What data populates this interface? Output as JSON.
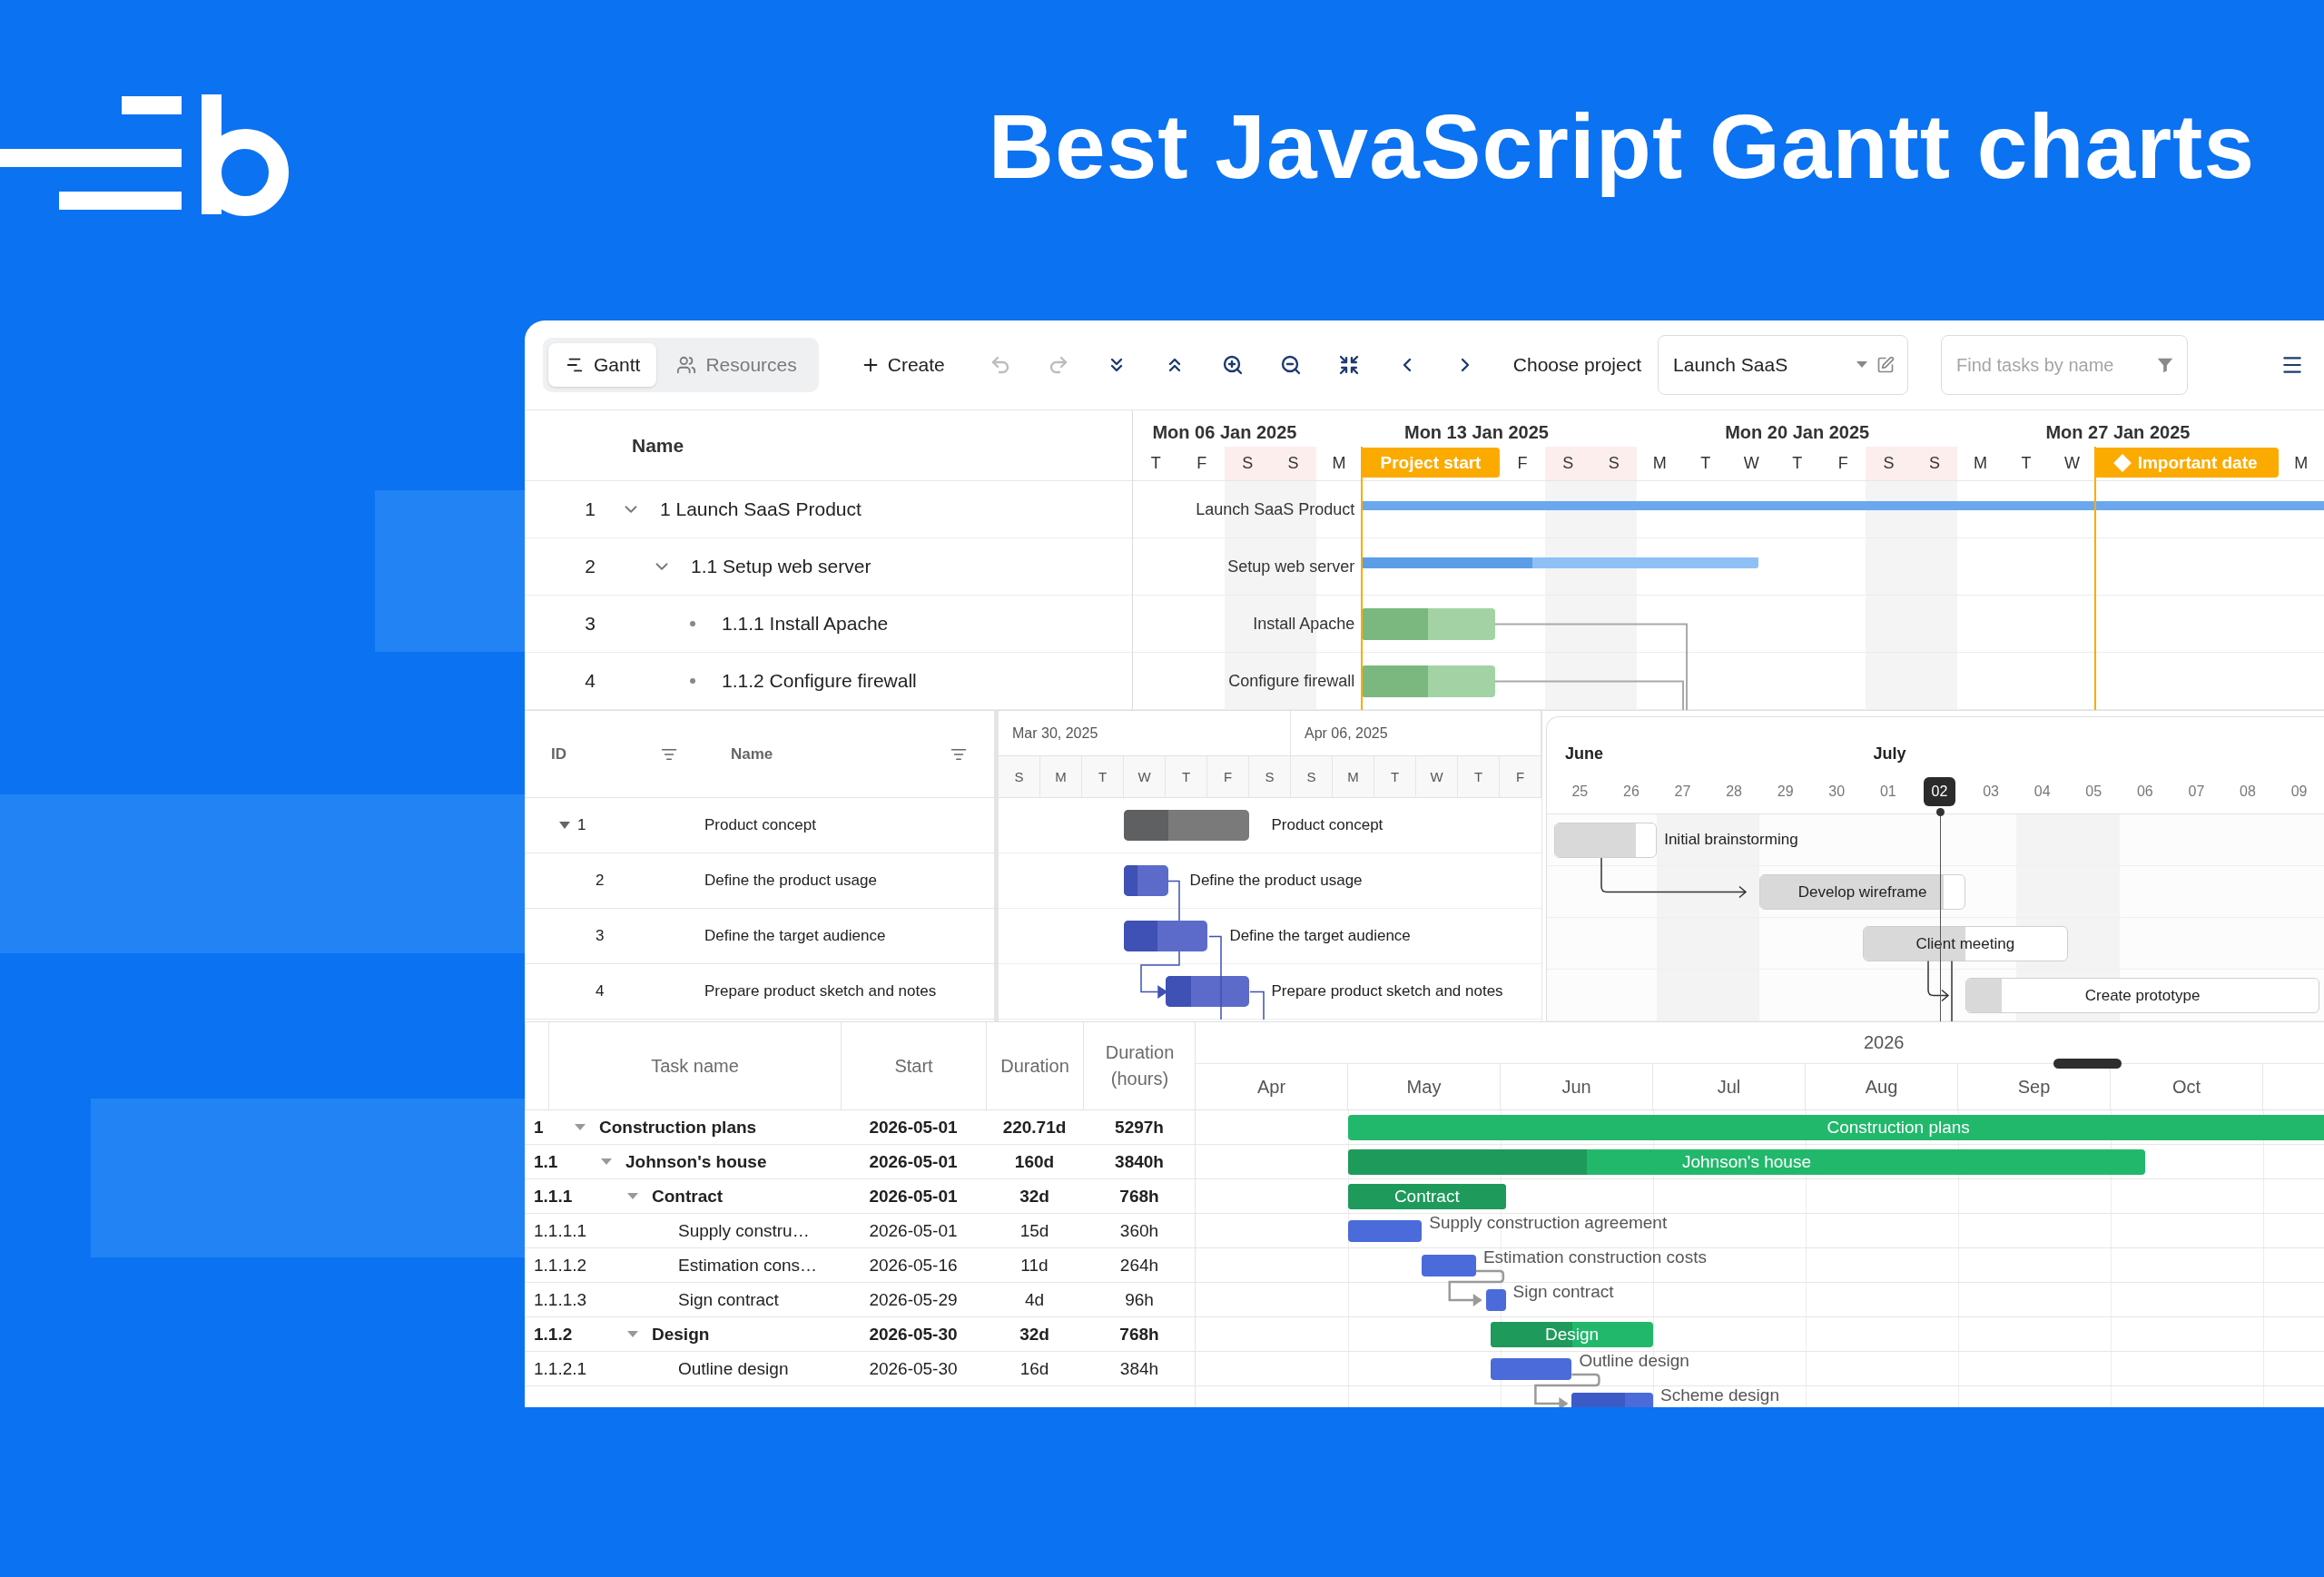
{
  "title": "Best JavaScript Gantt charts",
  "gantt": {
    "tabs": [
      {
        "kind": "gantt",
        "label": "Gantt",
        "selected": true
      },
      {
        "kind": "resources",
        "label": "Resources",
        "selected": false
      }
    ],
    "create": "Create",
    "tools": [
      {
        "kind": "undo",
        "disabled": true
      },
      {
        "kind": "redo",
        "disabled": true
      },
      {
        "kind": "expand_all",
        "disabled": false
      },
      {
        "kind": "collapse_all",
        "disabled": false
      },
      {
        "kind": "zoom_in",
        "disabled": false
      },
      {
        "kind": "zoom_out",
        "disabled": false
      },
      {
        "kind": "fit",
        "disabled": false
      },
      {
        "kind": "previous",
        "disabled": false
      },
      {
        "kind": "next",
        "disabled": false
      }
    ],
    "project_label": "Choose project",
    "project": "Launch SaaS",
    "search": {
      "placeholder": "Find tasks by name"
    },
    "name_header": "Name",
    "weeks": [
      "Mon 06 Jan 2025",
      "Mon 13 Jan 2025",
      "Mon 20 Jan 2025",
      "Mon 27 Jan 2025"
    ],
    "days": [
      {
        "kind": "day",
        "letter": "T",
        "weekend": false
      },
      {
        "kind": "day",
        "letter": "F",
        "weekend": false
      },
      {
        "kind": "day",
        "letter": "S",
        "weekend": true
      },
      {
        "kind": "day",
        "letter": "S",
        "weekend": true
      },
      {
        "kind": "day",
        "letter": "M",
        "weekend": false
      },
      {
        "kind": "marker",
        "label": "Project start"
      },
      {
        "kind": "day",
        "letter": "F",
        "weekend": false
      },
      {
        "kind": "day",
        "letter": "S",
        "weekend": true
      },
      {
        "kind": "day",
        "letter": "S",
        "weekend": true
      },
      {
        "kind": "day",
        "letter": "M",
        "weekend": false
      },
      {
        "kind": "day",
        "letter": "T",
        "weekend": false
      },
      {
        "kind": "day",
        "letter": "W",
        "weekend": false
      },
      {
        "kind": "day",
        "letter": "T",
        "weekend": false
      },
      {
        "kind": "day",
        "letter": "F",
        "weekend": false
      },
      {
        "kind": "day",
        "letter": "S",
        "weekend": true
      },
      {
        "kind": "day",
        "letter": "S",
        "weekend": true
      },
      {
        "kind": "day",
        "letter": "M",
        "weekend": false
      },
      {
        "kind": "day",
        "letter": "T",
        "weekend": false
      },
      {
        "kind": "day",
        "letter": "W",
        "weekend": false
      },
      {
        "kind": "milestone",
        "label": "Important date"
      },
      {
        "kind": "day",
        "letter": "M",
        "weekend": false
      }
    ],
    "tasks": [
      {
        "id": "1",
        "name": "1 Launch SaaS Product",
        "label": "Launch SaaS Product",
        "kind": "project",
        "expanded": true,
        "children": [
          {
            "id": "2",
            "name": "1.1 Setup web server",
            "label": "Setup web server",
            "kind": "summary",
            "level": 0.43,
            "expanded": true,
            "children": [
              {
                "id": "3",
                "name": "1.1.1 Install Apache",
                "label": "Install Apache",
                "kind": "task",
                "level": 0.5
              },
              {
                "id": "4",
                "name": "1.1.2 Configure firewall",
                "label": "Configure firewall",
                "kind": "task",
                "level": 0.5
              }
            ]
          }
        ]
      }
    ]
  },
  "scheduler": {
    "columns": [
      "ID",
      "Name"
    ],
    "weeks": [
      "Mar 30, 2025",
      "Apr 06, 2025"
    ],
    "days": [
      "S",
      "M",
      "T",
      "W",
      "T",
      "F",
      "S",
      "S",
      "M",
      "T",
      "W",
      "T",
      "F"
    ],
    "tasks": [
      {
        "id": "1",
        "name": "Product concept",
        "label": "Product concept",
        "kind": "summary",
        "level": 0.35,
        "expanded": true,
        "children": [
          {
            "id": "2",
            "name": "Define the product usage",
            "label": "Define the product usage",
            "kind": "task",
            "level": 0.3
          },
          {
            "id": "3",
            "name": "Define the target audience",
            "label": "Define the target audience",
            "kind": "task",
            "level": 0.4
          },
          {
            "id": "4",
            "name": "Prepare product sketch and notes",
            "label": "Prepare product sketch and notes",
            "kind": "task",
            "level": 0.3
          }
        ]
      }
    ]
  },
  "timeline": {
    "months": [
      {
        "label": "June",
        "days": [
          {
            "label": "25",
            "selected": false,
            "weekend": false
          },
          {
            "label": "26",
            "selected": false,
            "weekend": false
          },
          {
            "label": "27",
            "selected": false,
            "weekend": true
          },
          {
            "label": "28",
            "selected": false,
            "weekend": true
          },
          {
            "label": "29",
            "selected": false,
            "weekend": false
          },
          {
            "label": "30",
            "selected": false,
            "weekend": false
          }
        ]
      },
      {
        "label": "July",
        "days": [
          {
            "label": "01",
            "selected": false,
            "weekend": false
          },
          {
            "label": "02",
            "selected": true,
            "weekend": false
          },
          {
            "label": "03",
            "selected": false,
            "weekend": false
          },
          {
            "label": "04",
            "selected": false,
            "weekend": true
          },
          {
            "label": "05",
            "selected": false,
            "weekend": true
          },
          {
            "label": "06",
            "selected": false,
            "weekend": false
          },
          {
            "label": "07",
            "selected": false,
            "weekend": false
          },
          {
            "label": "08",
            "selected": false,
            "weekend": false
          },
          {
            "label": "09",
            "selected": false,
            "weekend": false
          }
        ]
      }
    ],
    "tasks": [
      {
        "name": "Initial brainstorming",
        "level": 0.8,
        "label_inside": false
      },
      {
        "name": "Develop wireframe",
        "level": 0.9,
        "label_inside": true
      },
      {
        "name": "Client meeting",
        "level": 0.5,
        "label_inside": true
      },
      {
        "name": "Create prototype",
        "level": 0.1,
        "label_inside": true
      }
    ]
  },
  "schedule": {
    "columns": [
      "Task name",
      "Start",
      "Duration",
      "Duration (hours)"
    ],
    "year": "2026",
    "months": [
      "Apr",
      "May",
      "Jun",
      "Jul",
      "Aug",
      "Sep",
      "Oct"
    ],
    "rows": [
      {
        "wbs": "1",
        "name": "Construction plans",
        "label": "Construction plans",
        "kind": "parent",
        "start": "2026-05-01",
        "duration": "220.71d",
        "hours": "5297h",
        "expanded": true,
        "children": [
          {
            "wbs": "1.1",
            "name": "Johnson's house",
            "label": "Johnson's house",
            "kind": "parent",
            "start": "2026-05-01",
            "duration": "160d",
            "hours": "3840h",
            "level": 0.3,
            "expanded": true,
            "children": [
              {
                "wbs": "1.1.1",
                "name": "Contract",
                "label": "Contract",
                "kind": "parent",
                "start": "2026-05-01",
                "duration": "32d",
                "hours": "768h",
                "level": 1,
                "expanded": true,
                "children": [
                  {
                    "wbs": "1.1.1.1",
                    "name": "Supply constru…",
                    "label": "Supply construction agreement",
                    "kind": "task",
                    "start": "2026-05-01",
                    "duration": "15d",
                    "hours": "360h"
                  },
                  {
                    "wbs": "1.1.1.2",
                    "name": "Estimation cons…",
                    "label": "Estimation construction costs",
                    "kind": "task",
                    "start": "2026-05-16",
                    "duration": "11d",
                    "hours": "264h"
                  },
                  {
                    "wbs": "1.1.1.3",
                    "name": "Sign contract",
                    "label": "Sign contract",
                    "kind": "task",
                    "start": "2026-05-29",
                    "duration": "4d",
                    "hours": "96h"
                  }
                ]
              },
              {
                "wbs": "1.1.2",
                "name": "Design",
                "label": "Design",
                "kind": "parent",
                "start": "2026-05-30",
                "duration": "32d",
                "hours": "768h",
                "level": 0.5,
                "expanded": true,
                "children": [
                  {
                    "wbs": "1.1.2.1",
                    "name": "Outline design",
                    "label": "Outline design",
                    "kind": "task",
                    "start": "2026-05-30",
                    "duration": "16d",
                    "hours": "384h"
                  },
                  {
                    "label": "Scheme design",
                    "kind": "task",
                    "level": 0.65
                  }
                ]
              }
            ]
          }
        ]
      }
    ]
  }
}
